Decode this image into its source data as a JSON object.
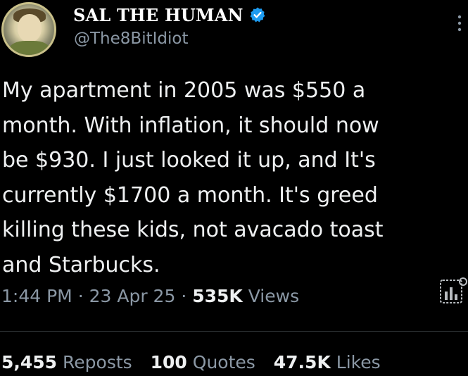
{
  "author": {
    "display_name": "SAL THE HUMAN",
    "handle": "@The8BitIdiot"
  },
  "tweet": {
    "text": "My apartment in 2005 was $550 a\nmonth. With inflation, it should now\nbe $930. I just looked it up, and It's\ncurrently $1700 a month. It's greed\nkilling these kids, not avacado toast\nand Starbucks.",
    "time": "1:44 PM",
    "date": "23 Apr 25",
    "separator": "·",
    "views_count": "535K",
    "views_label": "Views"
  },
  "stats": {
    "reposts_count": "5,455",
    "reposts_label": "Reposts",
    "quotes_count": "100",
    "quotes_label": "Quotes",
    "likes_count": "47.5K",
    "likes_label": "Likes"
  },
  "icons": {
    "verified": "verified-badge-icon",
    "more": "more-vertical-icon",
    "analytics": "analytics-icon"
  },
  "colors": {
    "background": "#000000",
    "text_primary": "#e7e9ea",
    "text_secondary": "#8b98a5",
    "verified_blue": "#1d9bf0",
    "divider": "#2f3336"
  }
}
